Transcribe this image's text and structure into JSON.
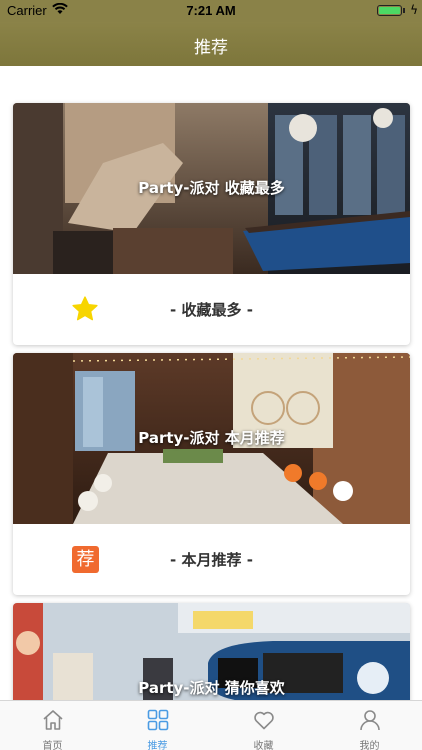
{
  "status_bar": {
    "carrier": "Carrier",
    "time": "7:21 AM",
    "battery_level": 1.0,
    "charging_symbol": "ϟ"
  },
  "nav": {
    "title": "推荐"
  },
  "cards": [
    {
      "caption": "Party-派对 收藏最多",
      "label": "- 收藏最多 -",
      "icon": "star-icon"
    },
    {
      "caption": "Party-派对 本月推荐",
      "label": "- 本月推荐 -",
      "icon": "recommend-icon",
      "icon_text": "荐"
    },
    {
      "caption": "Party-派对 猜你喜欢",
      "label": "",
      "icon": ""
    }
  ],
  "tabs": [
    {
      "label": "首页",
      "icon": "home-icon",
      "active": false
    },
    {
      "label": "推荐",
      "icon": "grid-icon",
      "active": true
    },
    {
      "label": "收藏",
      "icon": "heart-icon",
      "active": false
    },
    {
      "label": "我的",
      "icon": "person-icon",
      "active": false
    }
  ],
  "colors": {
    "nav_bar": "#8a8248",
    "tab_active": "#4a9be3",
    "tab_inactive": "#777777",
    "star": "#f7d500",
    "recommend_badge": "#f06a2f"
  }
}
